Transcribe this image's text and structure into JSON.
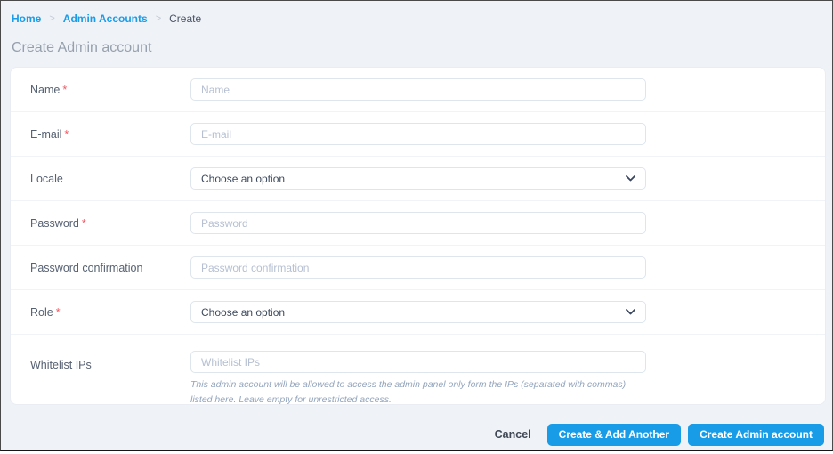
{
  "breadcrumb": {
    "separator": ">",
    "items": [
      {
        "label": "Home"
      },
      {
        "label": "Admin Accounts"
      },
      {
        "label": "Create"
      }
    ]
  },
  "page": {
    "title": "Create Admin account"
  },
  "form": {
    "fields": [
      {
        "label": "Name",
        "required": "*",
        "placeholder": "Name",
        "type": "text"
      },
      {
        "label": "E-mail",
        "required": "*",
        "placeholder": "E-mail",
        "type": "text"
      },
      {
        "label": "Locale",
        "required": "",
        "value": "Choose an option",
        "type": "select"
      },
      {
        "label": "Password",
        "required": "*",
        "placeholder": "Password",
        "type": "password"
      },
      {
        "label": "Password confirmation",
        "required": "",
        "placeholder": "Password confirmation",
        "type": "password"
      },
      {
        "label": "Role",
        "required": "*",
        "value": "Choose an option",
        "type": "select"
      },
      {
        "label": "Whitelist IPs",
        "required": "",
        "placeholder": "Whitelist IPs",
        "type": "text",
        "help": "This admin account will be allowed to access the admin panel only form the IPs (separated with commas) listed here. Leave empty for unrestricted access."
      }
    ]
  },
  "footer": {
    "cancel_label": "Cancel",
    "create_add_label": "Create & Add Another",
    "create_label": "Create Admin account"
  },
  "colors": {
    "primary": "#189ce8",
    "link": "#1a9ce9",
    "required": "#ee5a64",
    "page_bg": "#eff2f7"
  }
}
